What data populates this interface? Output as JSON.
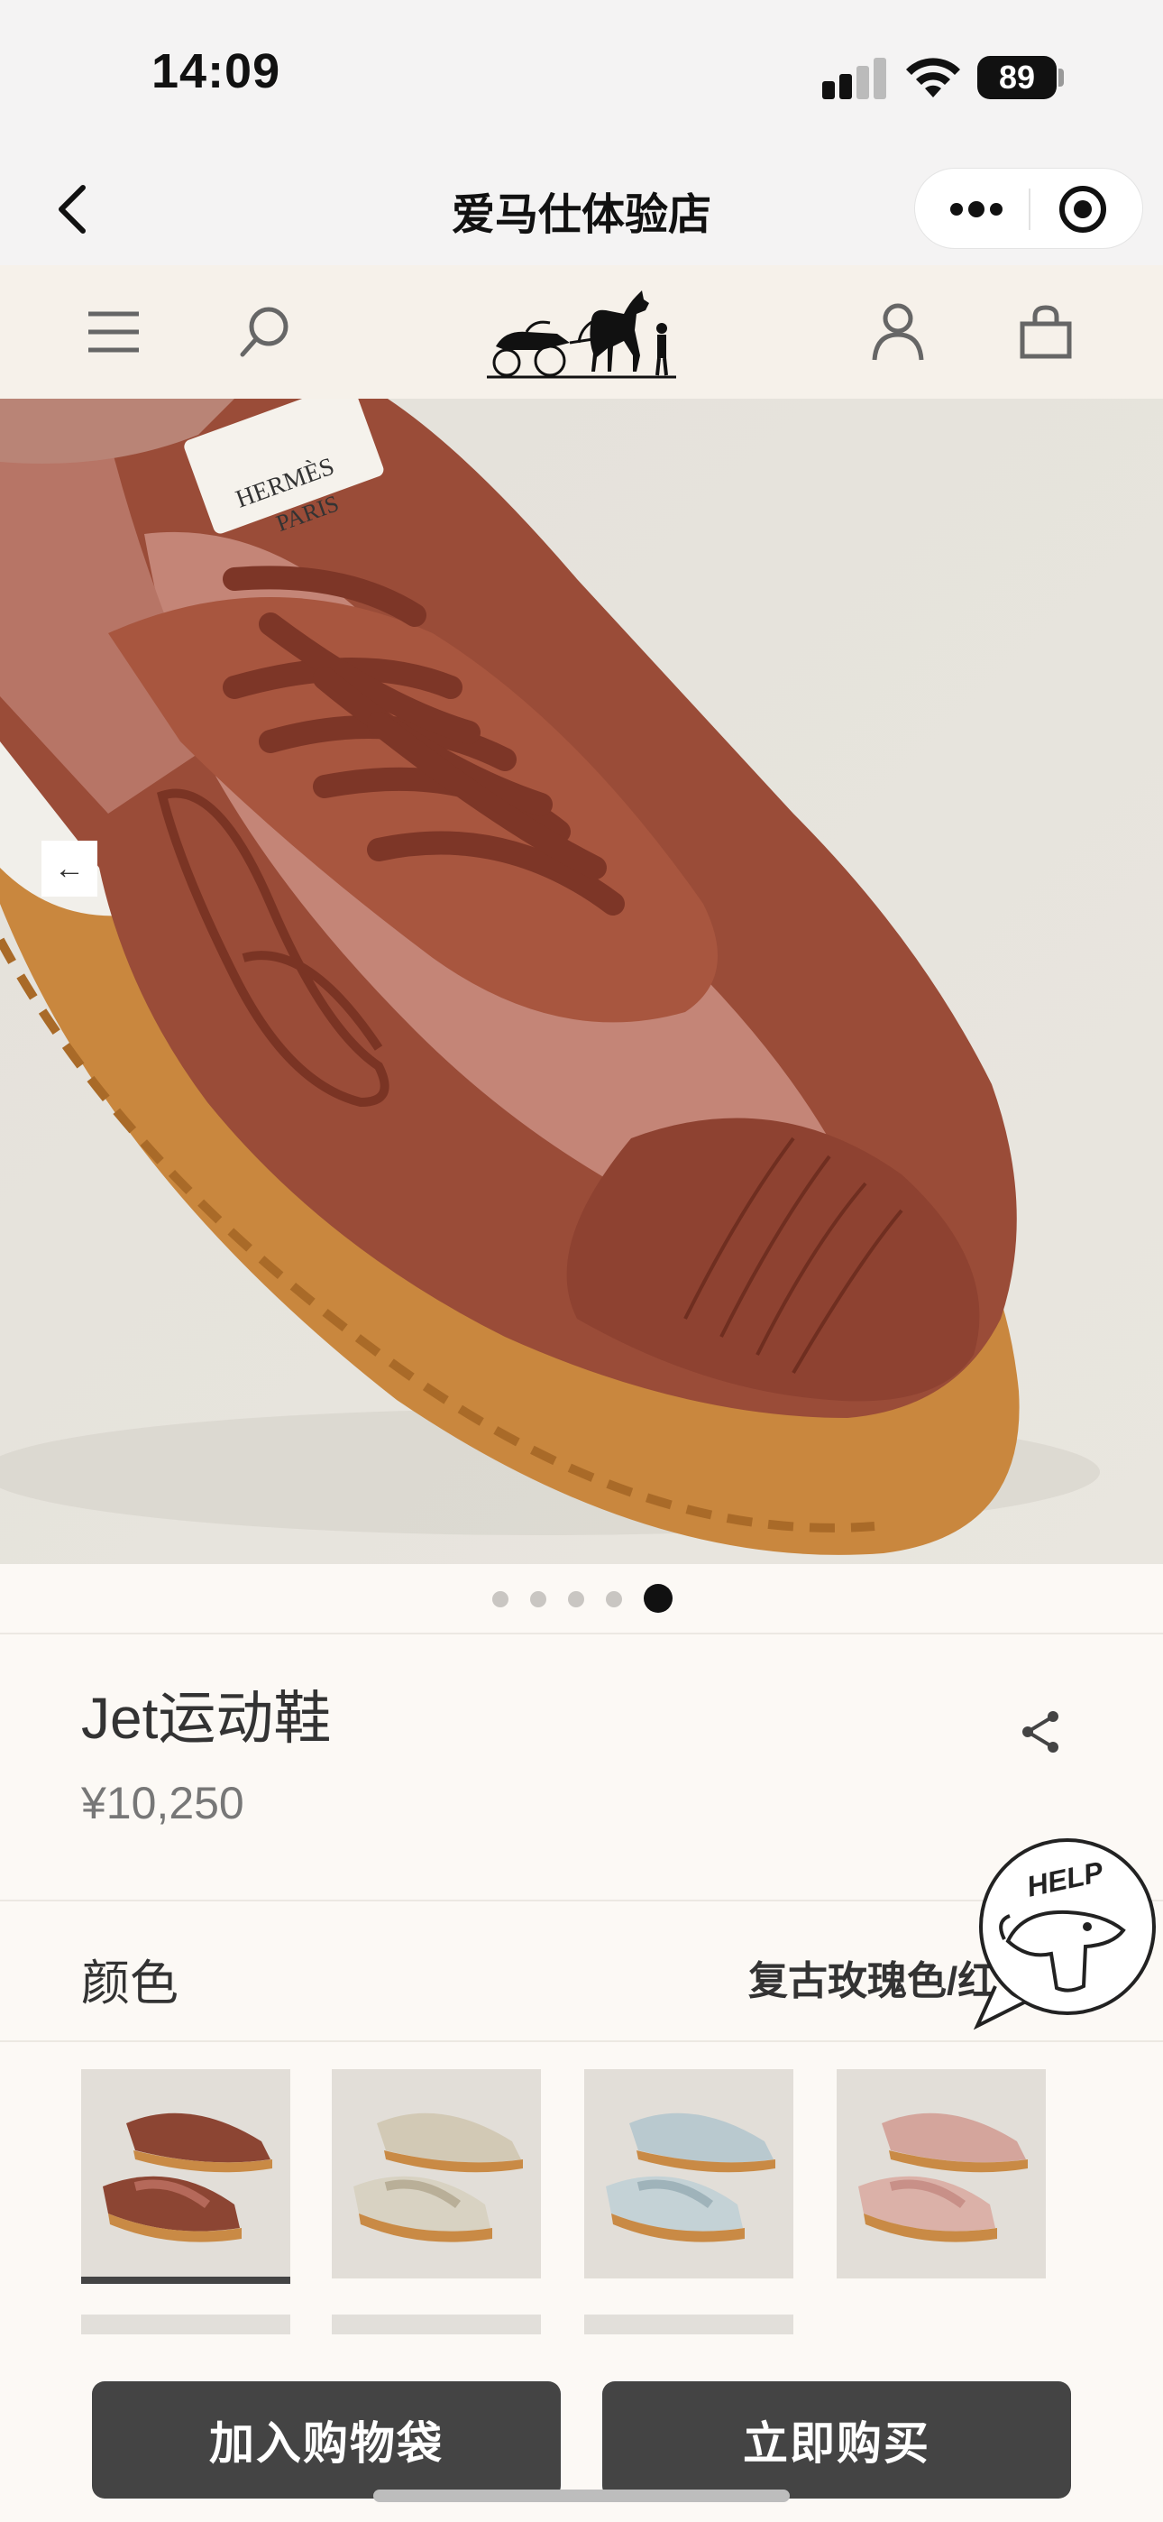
{
  "status_bar": {
    "time": "14:09",
    "battery": "89",
    "icons": [
      "signal-icon",
      "wifi-icon",
      "battery-icon"
    ]
  },
  "title_bar": {
    "title": "爱马仕体验店",
    "icons": [
      "back-icon",
      "more-icon",
      "close-target-icon"
    ]
  },
  "site_header": {
    "icons": [
      "menu-icon",
      "search-icon",
      "carriage-logo",
      "account-icon",
      "bag-icon"
    ]
  },
  "hero": {
    "shoe_tag_line1": "HERMÈS",
    "shoe_tag_line2": "PARIS",
    "back_arrow": "←",
    "carousel": {
      "count": 5,
      "active_index": 4
    }
  },
  "product": {
    "name": "Jet运动鞋",
    "price": "¥10,250"
  },
  "color": {
    "label": "颜色",
    "value": "复古玫瑰色/红"
  },
  "help": {
    "label": "HELP"
  },
  "swatches": {
    "selected_index": 0,
    "items": [
      {
        "name": "rust",
        "upper": "#8c4533",
        "panel": "#b5695a",
        "sole": "#c98a45"
      },
      {
        "name": "beige",
        "upper": "#d2c9b5",
        "panel": "#b9af98",
        "sole": "#c98a45"
      },
      {
        "name": "blue-grey",
        "upper": "#b9c9cf",
        "panel": "#9fb3ba",
        "sole": "#c98a45"
      },
      {
        "name": "rose",
        "upper": "#d4a59c",
        "panel": "#c89088",
        "sole": "#c98a45"
      }
    ]
  },
  "actions": {
    "add_to_bag": "加入购物袋",
    "buy_now": "立即购买"
  }
}
